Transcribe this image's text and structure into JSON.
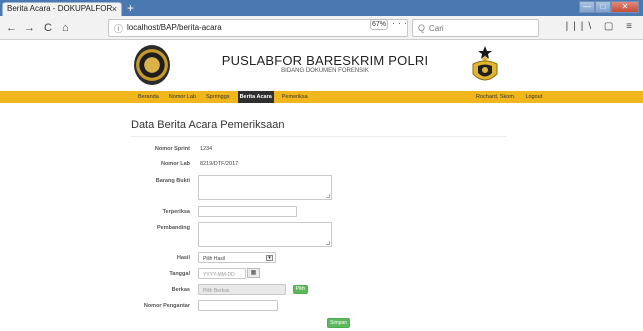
{
  "browser": {
    "tab_title": "Berita Acara - DOKUPALFOR",
    "tab_close": "×",
    "new_tab": "+",
    "back": "←",
    "forward": "→",
    "reload": "C",
    "home": "⌂",
    "info": "ⓘ",
    "url": "localhost/BAP/berita-acara",
    "zoom": "67%",
    "url_icons": "··· ♡ ☆",
    "search_icon": "Q",
    "search_placeholder": "Cari",
    "right_icons": "|||\\ ▢ ≡",
    "win_min": "—",
    "win_max": "□",
    "win_close": "✕"
  },
  "header": {
    "title": "PUSLABFOR BARESKRIM POLRI",
    "subtitle": "BIDANG DOKUMEN FORENSIK"
  },
  "menu": {
    "items": [
      "Beranda",
      "Nomor Lab",
      "Sprringgs",
      "Berita Acara",
      "Pemeriksa"
    ],
    "active_index": 3,
    "right_items": [
      "Rochard, Skom.",
      "Logout"
    ]
  },
  "form": {
    "title": "Data Berita Acara Pemeriksaan",
    "labels": {
      "nomor_sprint": "Nomor Sprint",
      "nomor_lab": "Nomor Lab",
      "barang_bukti": "Barang Bukti",
      "terperiksa": "Terperiksa",
      "pembanding": "Pembanding",
      "hasil": "Hasil",
      "tanggal": "Tanggal",
      "berkas": "Berkas",
      "nomor_pengantar": "Nomor Pengantar"
    },
    "values": {
      "nomor_sprint": "1234",
      "nomor_lab": "8219/DTF/2017"
    },
    "hasil_selected": "Pilih Hasil",
    "tanggal_placeholder": "YYYY-MM-DD",
    "berkas_placeholder": "Pilih Berkas",
    "pilih_button": "Pilih",
    "simpan_button": "Simpan",
    "calendar_icon": "▦",
    "select_arrow": "▾"
  },
  "colors": {
    "menubar": "#f0b71c",
    "active_menu": "#2f2f2f",
    "button_green": "#5cb85c",
    "titlebar": "#4a78b0"
  }
}
